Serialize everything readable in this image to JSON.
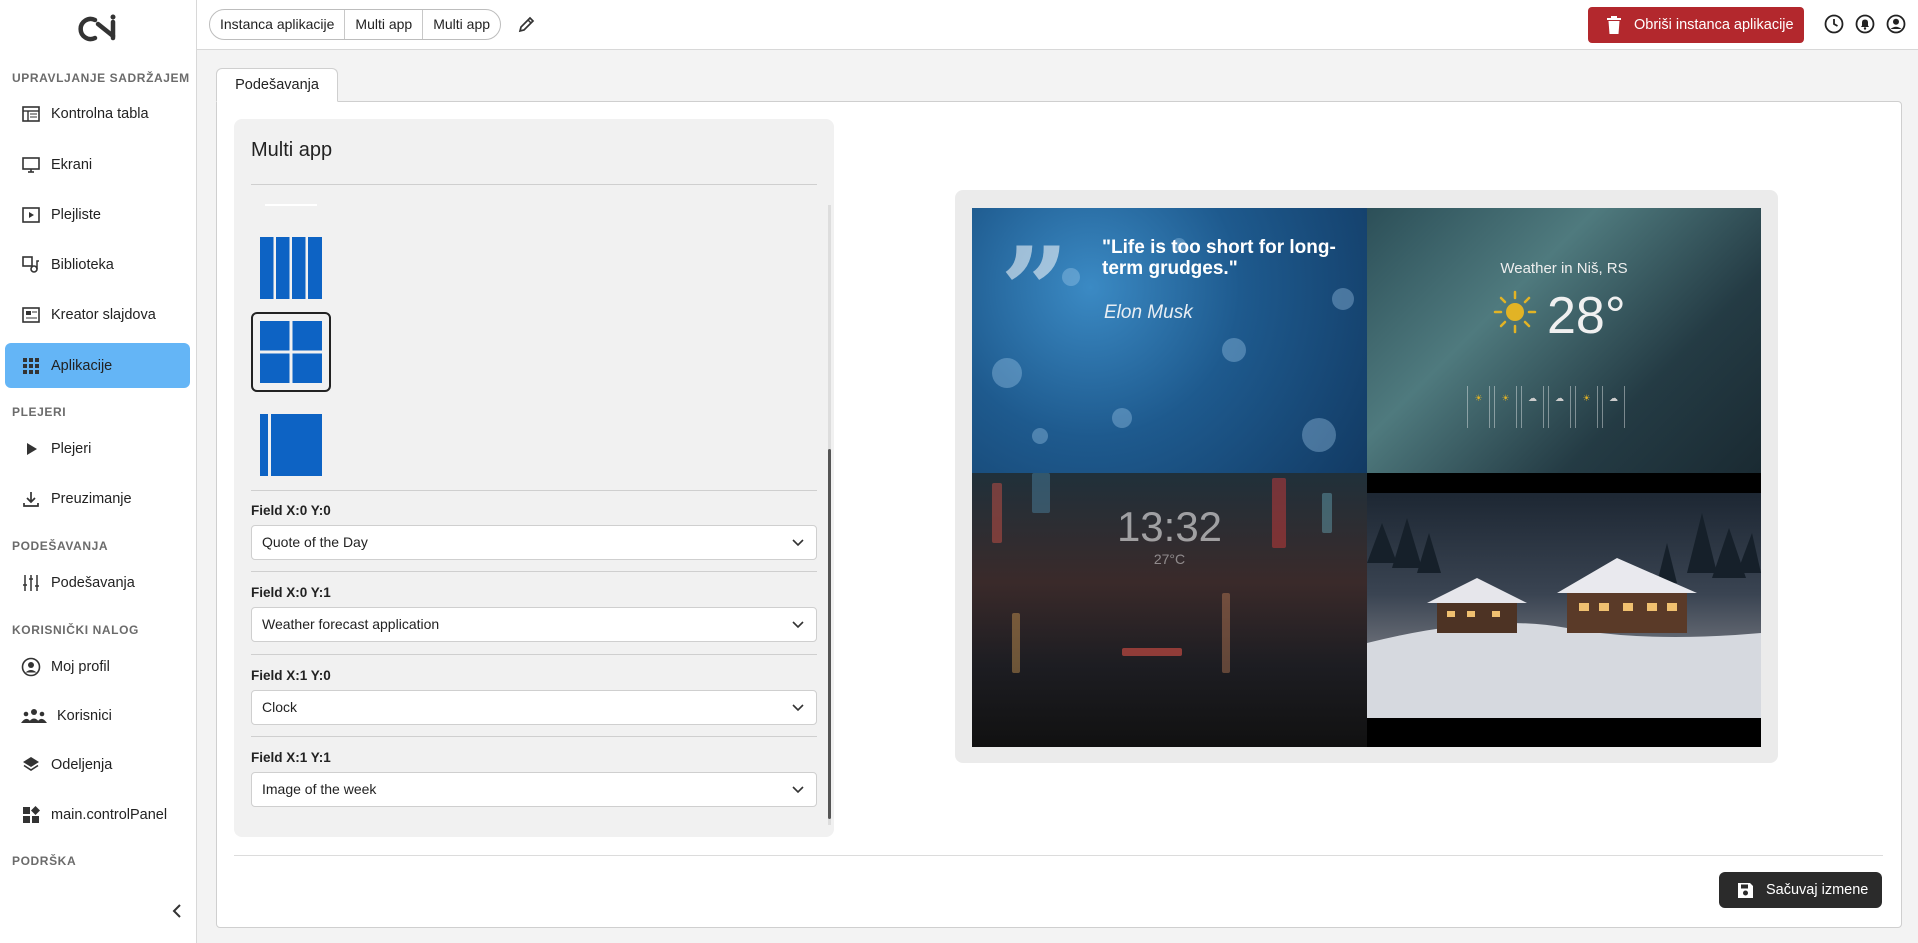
{
  "sidebar": {
    "sections": [
      {
        "heading": "UPRAVLJANJE SADRŽAJEM"
      },
      {
        "heading": "PLEJERI"
      },
      {
        "heading": "PODEŠAVANJA"
      },
      {
        "heading": "KORISNIČKI NALOG"
      },
      {
        "heading": "PODRŠKA"
      }
    ],
    "items": [
      {
        "label": "Kontrolna tabla",
        "icon": "dashboard-icon"
      },
      {
        "label": "Ekrani",
        "icon": "monitor-icon"
      },
      {
        "label": "Plejliste",
        "icon": "playlist-icon"
      },
      {
        "label": "Biblioteka",
        "icon": "library-icon"
      },
      {
        "label": "Kreator slajdova",
        "icon": "slide-creator-icon"
      },
      {
        "label": "Aplikacije",
        "icon": "apps-grid-icon",
        "active": true
      },
      {
        "label": "Plejeri",
        "icon": "play-icon"
      },
      {
        "label": "Preuzimanje",
        "icon": "download-icon"
      },
      {
        "label": "Podešavanja",
        "icon": "sliders-icon"
      },
      {
        "label": "Moj profil",
        "icon": "profile-icon"
      },
      {
        "label": "Korisnici",
        "icon": "users-icon"
      },
      {
        "label": "Odeljenja",
        "icon": "layers-icon"
      },
      {
        "label": "main.controlPanel",
        "icon": "widgets-icon"
      }
    ]
  },
  "topbar": {
    "breadcrumb": [
      "Instanca aplikacije",
      "Multi app",
      "Multi app"
    ],
    "delete_label": "Obriši instanca aplikacije"
  },
  "main": {
    "tab_label": "Podešavanja",
    "panel_title": "Multi app",
    "layouts": [
      "four-columns",
      "two-by-two-grid",
      "sidebar-main"
    ],
    "selected_layout": "two-by-two-grid",
    "fields": [
      {
        "label": "Field X:0 Y:0",
        "value": "Quote of the Day"
      },
      {
        "label": "Field X:0 Y:1",
        "value": "Weather forecast application"
      },
      {
        "label": "Field X:1 Y:0",
        "value": "Clock"
      },
      {
        "label": "Field X:1 Y:1",
        "value": "Image of the week"
      }
    ],
    "save_label": "Sačuvaj izmene"
  },
  "preview": {
    "quote_text": "\"Life is too short for long-term grudges.\"",
    "quote_author": "Elon Musk",
    "weather_title": "Weather in Niš, RS",
    "weather_temp": "28°",
    "clock_time": "13:32",
    "clock_temp": "27°C"
  },
  "colors": {
    "accent": "#64b5f6",
    "danger": "#b3282d",
    "dark_button": "#2b2b2b",
    "layout_blue": "#0d63c4"
  }
}
